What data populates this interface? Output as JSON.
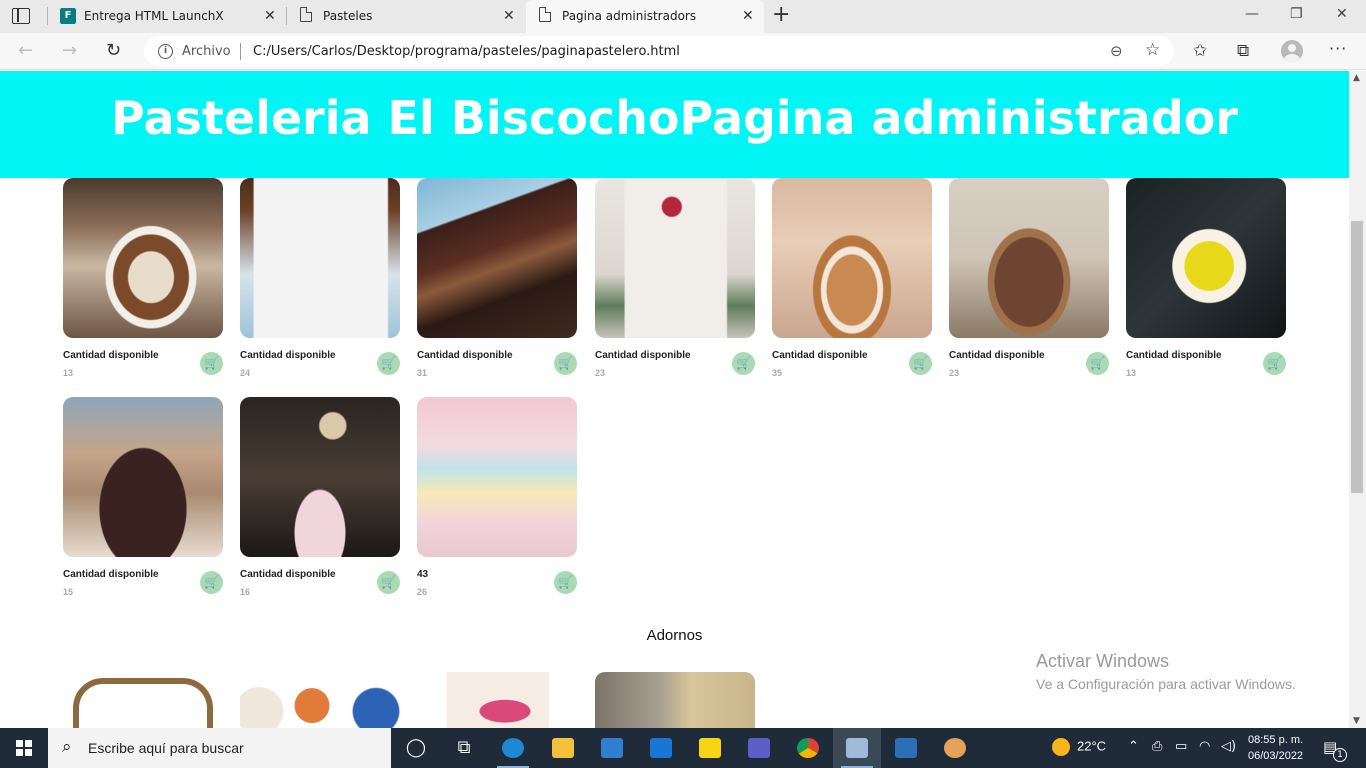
{
  "browser": {
    "tabs": [
      {
        "title": "Entrega HTML LaunchX"
      },
      {
        "title": "Pasteles"
      },
      {
        "title": "Pagina administradors"
      }
    ],
    "address": {
      "scheme_label": "Archivo",
      "url": "C:/Users/Carlos/Desktop/programa/pasteles/paginapastelero.html"
    }
  },
  "page": {
    "header_title": "Pasteleria El BiscochoPagina administrador",
    "products": [
      {
        "label": "Cantidad disponible",
        "qty": "13"
      },
      {
        "label": "Cantidad disponible",
        "qty": "24"
      },
      {
        "label": "Cantidad disponible",
        "qty": "31"
      },
      {
        "label": "Cantidad disponible",
        "qty": "23"
      },
      {
        "label": "Cantidad disponible",
        "qty": "35"
      },
      {
        "label": "Cantidad disponible",
        "qty": "23"
      },
      {
        "label": "Cantidad disponible",
        "qty": "13"
      },
      {
        "label": "Cantidad disponible",
        "qty": "15"
      },
      {
        "label": "Cantidad disponible",
        "qty": "16"
      },
      {
        "label": "43",
        "qty": "26"
      }
    ],
    "section_adornos": "Adornos"
  },
  "watermark": {
    "line1": "Activar Windows",
    "line2": "Ve a Configuración para activar Windows."
  },
  "taskbar": {
    "search_placeholder": "Escribe aquí para buscar",
    "weather": "22°C",
    "time": "08:55 p. m.",
    "date": "06/03/2022",
    "notifications": "1"
  },
  "colors": {
    "header_bg": "#00f5f5",
    "cart_button": "#a8dbb4",
    "taskbar_bg": "#1f2b38"
  }
}
